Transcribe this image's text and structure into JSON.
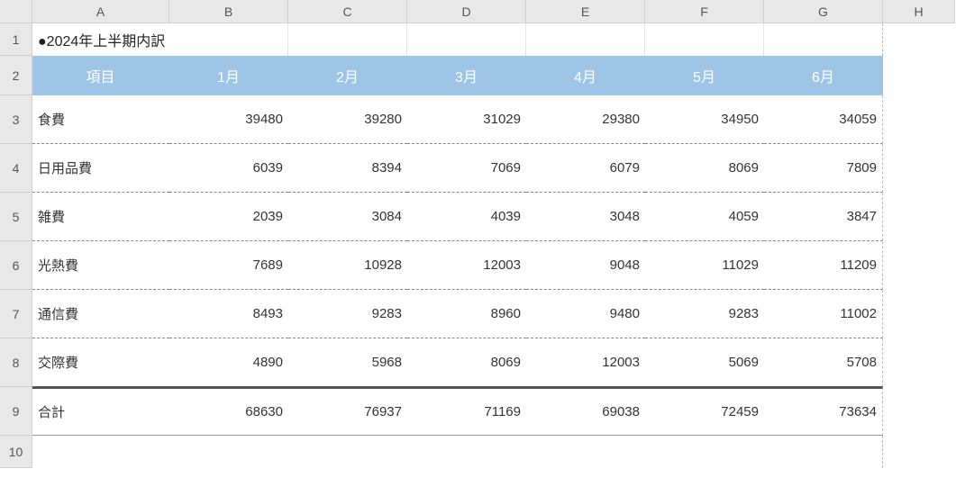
{
  "columns": [
    "A",
    "B",
    "C",
    "D",
    "E",
    "F",
    "G",
    "H"
  ],
  "rows": [
    "1",
    "2",
    "3",
    "4",
    "5",
    "6",
    "7",
    "8",
    "9",
    "10"
  ],
  "title": "●2024年上半期内訳",
  "header": {
    "item": "項目",
    "months": [
      "1月",
      "2月",
      "3月",
      "4月",
      "5月",
      "6月"
    ]
  },
  "chart_data": {
    "type": "table",
    "title": "2024年上半期内訳",
    "columns": [
      "項目",
      "1月",
      "2月",
      "3月",
      "4月",
      "5月",
      "6月"
    ],
    "rows": [
      {
        "label": "食費",
        "values": [
          39480,
          39280,
          31029,
          29380,
          34950,
          34059
        ]
      },
      {
        "label": "日用品費",
        "values": [
          6039,
          8394,
          7069,
          6079,
          8069,
          7809
        ]
      },
      {
        "label": "雑費",
        "values": [
          2039,
          3084,
          4039,
          3048,
          4059,
          3847
        ]
      },
      {
        "label": "光熱費",
        "values": [
          7689,
          10928,
          12003,
          9048,
          11029,
          11209
        ]
      },
      {
        "label": "通信費",
        "values": [
          8493,
          9283,
          8960,
          9480,
          9283,
          11002
        ]
      },
      {
        "label": "交際費",
        "values": [
          4890,
          5968,
          8069,
          12003,
          5069,
          5708
        ]
      }
    ],
    "total": {
      "label": "合計",
      "values": [
        68630,
        76937,
        71169,
        69038,
        72459,
        73634
      ]
    }
  }
}
